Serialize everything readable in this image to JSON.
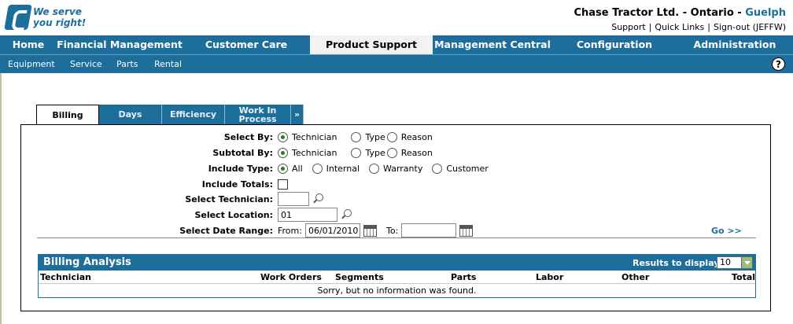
{
  "header": {
    "logo_line1": "We serve",
    "logo_line2": "you right!",
    "company": "Chase Tractor Ltd. - Ontario -",
    "city": "Guelph",
    "links": [
      "Support",
      "Quick Links",
      "Sign-out (JEFFW)"
    ]
  },
  "mainnav": [
    {
      "label": "Home"
    },
    {
      "label": "Financial Management"
    },
    {
      "label": "Customer Care"
    },
    {
      "label": "Product Support"
    },
    {
      "label": "Management Central"
    },
    {
      "label": "Configuration"
    },
    {
      "label": "Administration"
    }
  ],
  "subnav": [
    "Equipment",
    "Service",
    "Parts",
    "Rental"
  ],
  "help_label": "?",
  "tabs": [
    {
      "label": "Billing"
    },
    {
      "label": "Days"
    },
    {
      "label": "Efficiency"
    },
    {
      "label": "Work In Process"
    },
    {
      "label": "»"
    }
  ],
  "form": {
    "select_by": {
      "label": "Select By:",
      "options": [
        "Technician",
        "Type",
        "Reason"
      ],
      "selected": "Technician"
    },
    "subtotal_by": {
      "label": "Subtotal By:",
      "options": [
        "Technician",
        "Type",
        "Reason"
      ],
      "selected": "Technician"
    },
    "include_type": {
      "label": "Include Type:",
      "options": [
        "All",
        "Internal",
        "Warranty",
        "Customer"
      ],
      "selected": "All"
    },
    "include_totals": {
      "label": "Include Totals:",
      "checked": false
    },
    "select_technician": {
      "label": "Select Technician:",
      "value": ""
    },
    "select_location": {
      "label": "Select Location:",
      "value": "01"
    },
    "date_range": {
      "label": "Select Date Range:",
      "from_label": "From:",
      "from_value": "06/01/2010",
      "to_label": "To:",
      "to_value": ""
    },
    "go_label": "Go >>"
  },
  "analysis": {
    "title": "Billing Analysis",
    "results_label": "Results to display:",
    "results_value": "10",
    "columns": [
      "Technician",
      "Work Orders",
      "Segments",
      "Parts",
      "Labor",
      "Other",
      "Total"
    ],
    "empty_message": "Sorry, but no information was found."
  },
  "colors": {
    "brand_blue": "#1e6e9b",
    "active_tab_bg": "#f2f2f2",
    "radio_dot": "#2a7a2a"
  }
}
